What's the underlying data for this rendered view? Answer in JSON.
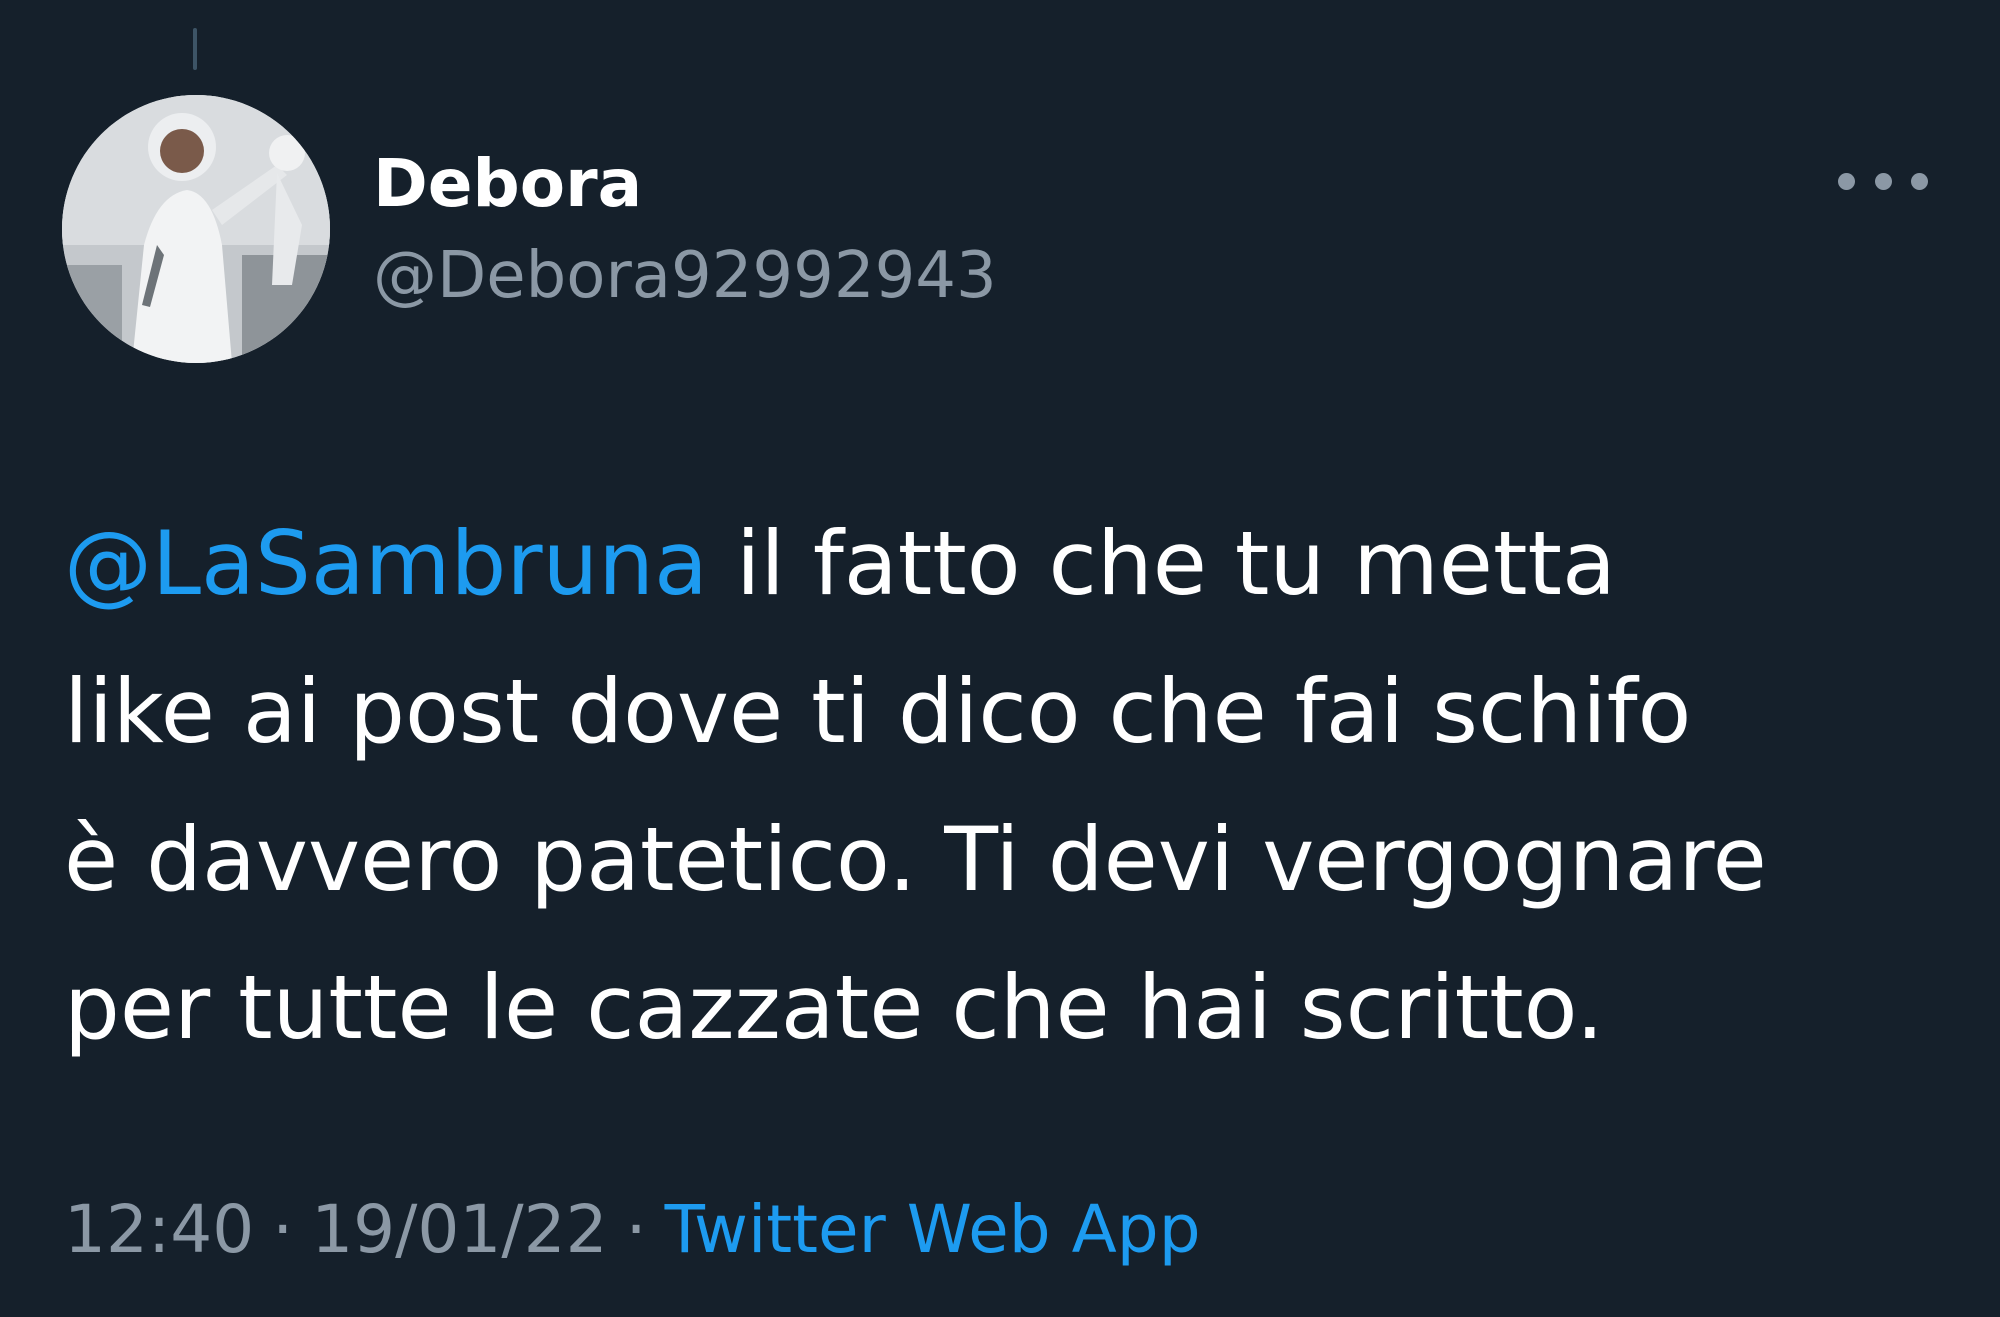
{
  "tweet": {
    "author": {
      "display_name": "Debora",
      "handle": "@Debora92992943",
      "avatar_icon": "profile-photo"
    },
    "more_icon": "more-horizontal-icon",
    "mention": "@LaSambruna",
    "text_lines": [
      " il fatto che tu metta",
      "like ai post dove ti dico che fai schifo",
      "è davvero patetico. Ti devi vergognare",
      "per tutte le cazzate che hai scritto."
    ],
    "time": "12:40",
    "separator": "·",
    "date": "19/01/22",
    "source": "Twitter Web App"
  },
  "colors": {
    "background": "#15202b",
    "primary_text": "#ffffff",
    "secondary_text": "#8b98a5",
    "link": "#1d9bf0"
  }
}
